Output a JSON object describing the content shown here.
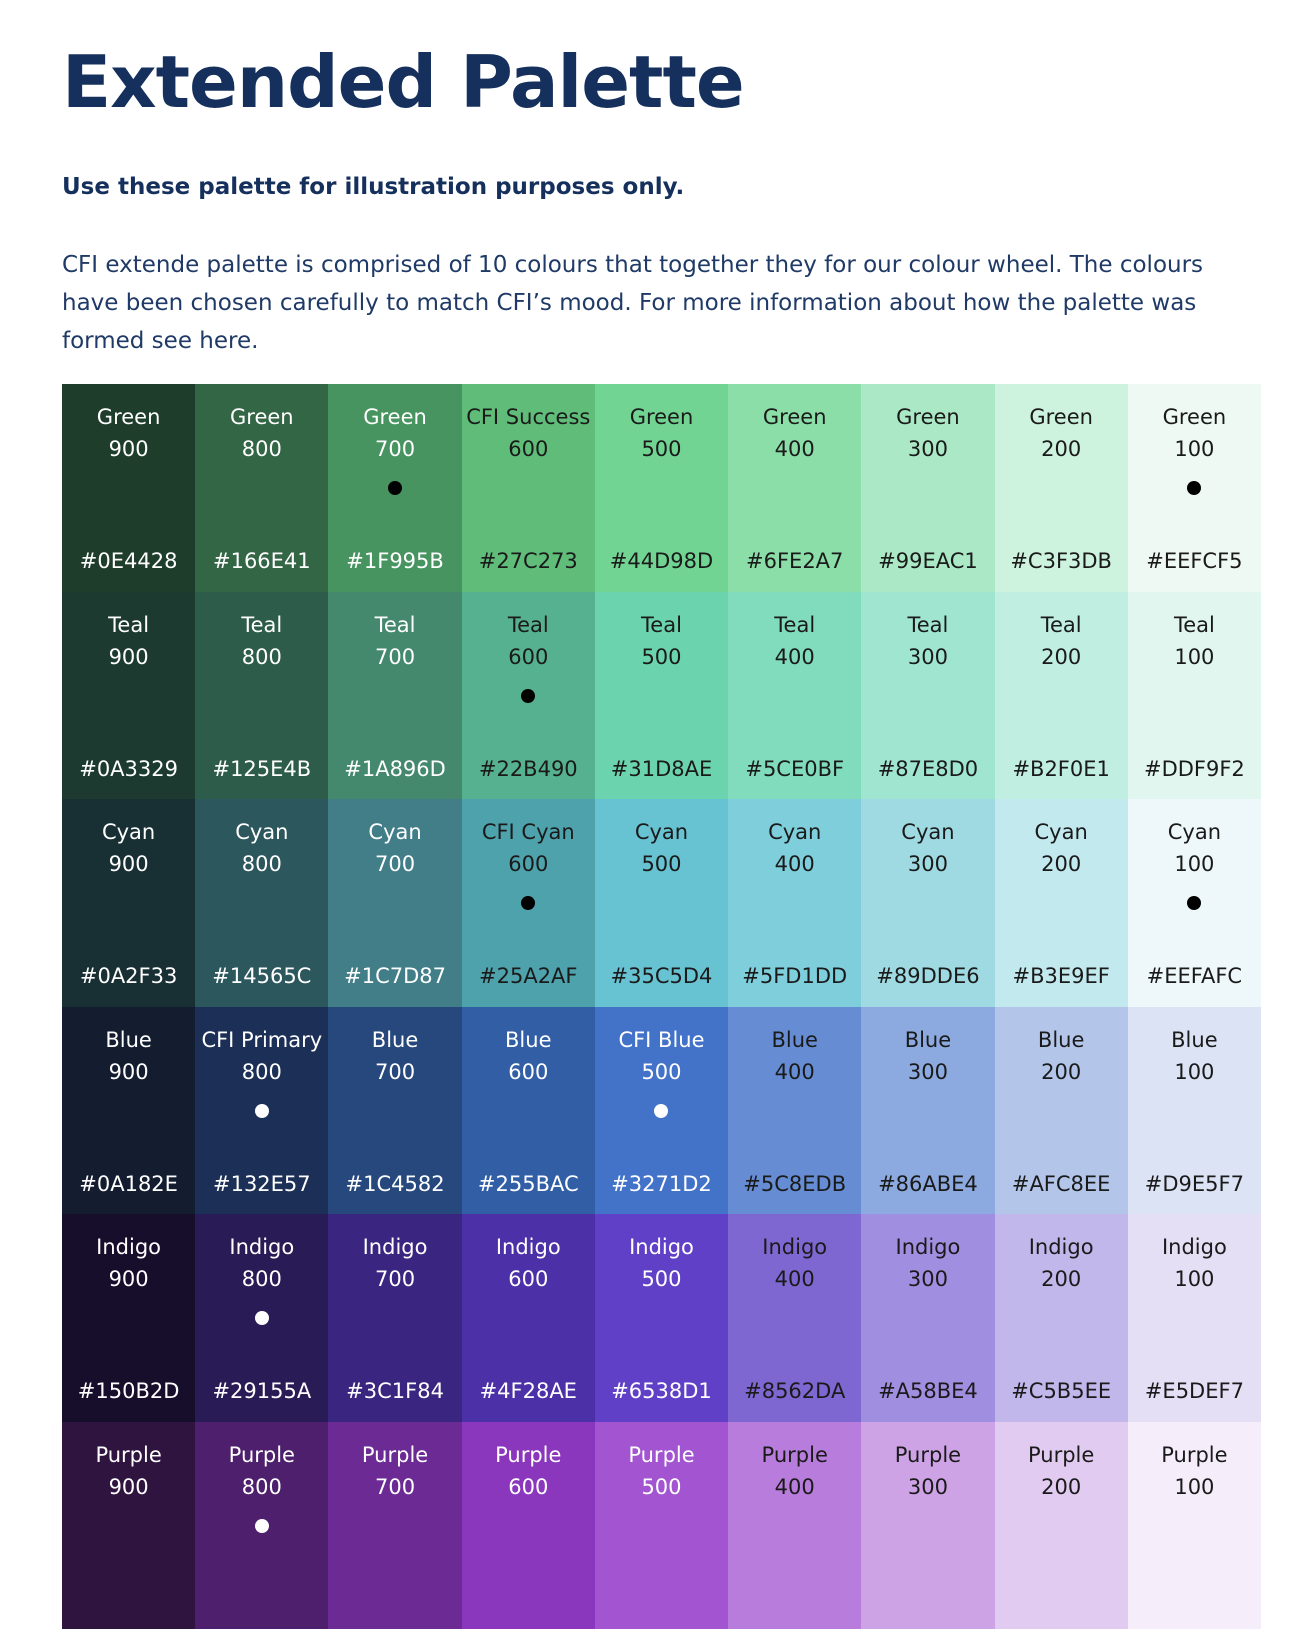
{
  "heading": "Extended Palette",
  "subheading": "Use these palette for illustration purposes only.",
  "intro": "CFI extende palette is comprised of 10 colours that together they for our colour wheel. The colours have been chosen carefully to match CFI’s mood. For more information about how the palette was formed see here.",
  "palette": [
    {
      "row": "green",
      "swatches": [
        {
          "name": "Green",
          "shade": "900",
          "hex": "#0E4428",
          "bg": "#1f3d2b",
          "fg": "#ffffff",
          "dot": false
        },
        {
          "name": "Green",
          "shade": "800",
          "hex": "#166E41",
          "bg": "#336645",
          "fg": "#ffffff",
          "dot": false
        },
        {
          "name": "Green",
          "shade": "700",
          "hex": "#1F995B",
          "bg": "#479460",
          "fg": "#ffffff",
          "dot": true,
          "dot_color": "#000000"
        },
        {
          "name": "CFI Success",
          "shade": "600",
          "hex": "#27C273",
          "bg": "#5fbd79",
          "fg": "#1a1a1a",
          "dot": false
        },
        {
          "name": "Green",
          "shade": "500",
          "hex": "#44D98D",
          "bg": "#72d493",
          "fg": "#1a1a1a",
          "dot": false
        },
        {
          "name": "Green",
          "shade": "400",
          "hex": "#6FE2A7",
          "bg": "#8bdea8",
          "fg": "#1a1a1a",
          "dot": false
        },
        {
          "name": "Green",
          "shade": "300",
          "hex": "#99EAC1",
          "bg": "#abe8c5",
          "fg": "#1a1a1a",
          "dot": false
        },
        {
          "name": "Green",
          "shade": "200",
          "hex": "#C3F3DB",
          "bg": "#cdf2de",
          "fg": "#1a1a1a",
          "dot": false
        },
        {
          "name": "Green",
          "shade": "100",
          "hex": "#EEFCF5",
          "bg": "#edf9f2",
          "fg": "#1a1a1a",
          "dot": true,
          "dot_color": "#000000"
        }
      ]
    },
    {
      "row": "teal",
      "swatches": [
        {
          "name": "Teal",
          "shade": "900",
          "hex": "#0A3329",
          "bg": "#1c3a2f",
          "fg": "#ffffff",
          "dot": false
        },
        {
          "name": "Teal",
          "shade": "800",
          "hex": "#125E4B",
          "bg": "#2d5c4b",
          "fg": "#ffffff",
          "dot": false
        },
        {
          "name": "Teal",
          "shade": "700",
          "hex": "#1A896D",
          "bg": "#44896e",
          "fg": "#ffffff",
          "dot": false
        },
        {
          "name": "Teal",
          "shade": "600",
          "hex": "#22B490",
          "bg": "#56b190",
          "fg": "#1a1a1a",
          "dot": true,
          "dot_color": "#000000"
        },
        {
          "name": "Teal",
          "shade": "500",
          "hex": "#31D8AE",
          "bg": "#6bd4ae",
          "fg": "#1a1a1a",
          "dot": false
        },
        {
          "name": "Teal",
          "shade": "400",
          "hex": "#5CE0BF",
          "bg": "#80dcbd",
          "fg": "#1a1a1a",
          "dot": false
        },
        {
          "name": "Teal",
          "shade": "300",
          "hex": "#87E8D0",
          "bg": "#9fe5d0",
          "fg": "#1a1a1a",
          "dot": false
        },
        {
          "name": "Teal",
          "shade": "200",
          "hex": "#B2F0E1",
          "bg": "#c0eee0",
          "fg": "#1a1a1a",
          "dot": false
        },
        {
          "name": "Teal",
          "shade": "100",
          "hex": "#DDF9F2",
          "bg": "#e1f6ef",
          "fg": "#1a1a1a",
          "dot": false
        }
      ]
    },
    {
      "row": "cyan",
      "swatches": [
        {
          "name": "Cyan",
          "shade": "900",
          "hex": "#0A2F33",
          "bg": "#182f33",
          "fg": "#ffffff",
          "dot": false
        },
        {
          "name": "Cyan",
          "shade": "800",
          "hex": "#14565C",
          "bg": "#2c575d",
          "fg": "#ffffff",
          "dot": false
        },
        {
          "name": "Cyan",
          "shade": "700",
          "hex": "#1C7D87",
          "bg": "#417e88",
          "fg": "#ffffff",
          "dot": false
        },
        {
          "name": "CFI Cyan",
          "shade": "600",
          "hex": "#25A2AF",
          "bg": "#4ea2ac",
          "fg": "#1a1a1a",
          "dot": true,
          "dot_color": "#000000"
        },
        {
          "name": "Cyan",
          "shade": "500",
          "hex": "#35C5D4",
          "bg": "#67c2d1",
          "fg": "#1a1a1a",
          "dot": false
        },
        {
          "name": "Cyan",
          "shade": "400",
          "hex": "#5FD1DD",
          "bg": "#7ecedb",
          "fg": "#1a1a1a",
          "dot": false
        },
        {
          "name": "Cyan",
          "shade": "300",
          "hex": "#89DDE6",
          "bg": "#9fdae3",
          "fg": "#1a1a1a",
          "dot": false
        },
        {
          "name": "Cyan",
          "shade": "200",
          "hex": "#B3E9EF",
          "bg": "#c1e9ee",
          "fg": "#1a1a1a",
          "dot": false
        },
        {
          "name": "Cyan",
          "shade": "100",
          "hex": "#EEFAFC",
          "bg": "#eef8fa",
          "fg": "#1a1a1a",
          "dot": true,
          "dot_color": "#000000"
        }
      ]
    },
    {
      "row": "blue",
      "swatches": [
        {
          "name": "Blue",
          "shade": "900",
          "hex": "#0A182E",
          "bg": "#141c30",
          "fg": "#ffffff",
          "dot": false
        },
        {
          "name": "CFI Primary",
          "shade": "800",
          "hex": "#132E57",
          "bg": "#1c2f56",
          "fg": "#ffffff",
          "dot": true,
          "dot_color": "#ffffff"
        },
        {
          "name": "Blue",
          "shade": "700",
          "hex": "#1C4582",
          "bg": "#27487c",
          "fg": "#ffffff",
          "dot": false
        },
        {
          "name": "Blue",
          "shade": "600",
          "hex": "#255BAC",
          "bg": "#325ea6",
          "fg": "#ffffff",
          "dot": false
        },
        {
          "name": "CFI Blue",
          "shade": "500",
          "hex": "#3271D2",
          "bg": "#4372c9",
          "fg": "#ffffff",
          "dot": true,
          "dot_color": "#ffffff"
        },
        {
          "name": "Blue",
          "shade": "400",
          "hex": "#5C8EDB",
          "bg": "#668dd3",
          "fg": "#1a1a1a",
          "dot": false
        },
        {
          "name": "Blue",
          "shade": "300",
          "hex": "#86ABE4",
          "bg": "#8caadf",
          "fg": "#1a1a1a",
          "dot": false
        },
        {
          "name": "Blue",
          "shade": "200",
          "hex": "#AFC8EE",
          "bg": "#b3c6ea",
          "fg": "#1a1a1a",
          "dot": false
        },
        {
          "name": "Blue",
          "shade": "100",
          "hex": "#D9E5F7",
          "bg": "#dbe3f4",
          "fg": "#1a1a1a",
          "dot": false
        }
      ]
    },
    {
      "row": "indigo",
      "swatches": [
        {
          "name": "Indigo",
          "shade": "900",
          "hex": "#150B2D",
          "bg": "#160e2b",
          "fg": "#ffffff",
          "dot": false
        },
        {
          "name": "Indigo",
          "shade": "800",
          "hex": "#29155A",
          "bg": "#291b55",
          "fg": "#ffffff",
          "dot": true,
          "dot_color": "#ffffff"
        },
        {
          "name": "Indigo",
          "shade": "700",
          "hex": "#3C1F84",
          "bg": "#3a2580",
          "fg": "#ffffff",
          "dot": false
        },
        {
          "name": "Indigo",
          "shade": "600",
          "hex": "#4F28AE",
          "bg": "#4c30a8",
          "fg": "#ffffff",
          "dot": false
        },
        {
          "name": "Indigo",
          "shade": "500",
          "hex": "#6538D1",
          "bg": "#6140c8",
          "fg": "#ffffff",
          "dot": false
        },
        {
          "name": "Indigo",
          "shade": "400",
          "hex": "#8562DA",
          "bg": "#7e67d1",
          "fg": "#1a1a1a",
          "dot": false
        },
        {
          "name": "Indigo",
          "shade": "300",
          "hex": "#A58BE4",
          "bg": "#a08fe0",
          "fg": "#1a1a1a",
          "dot": false
        },
        {
          "name": "Indigo",
          "shade": "200",
          "hex": "#C5B5EE",
          "bg": "#c1b7eb",
          "fg": "#1a1a1a",
          "dot": false
        },
        {
          "name": "Indigo",
          "shade": "100",
          "hex": "#E5DEF7",
          "bg": "#e4dff4",
          "fg": "#1a1a1a",
          "dot": false
        }
      ]
    },
    {
      "row": "purple",
      "swatches": [
        {
          "name": "Purple",
          "shade": "900",
          "hex": "",
          "bg": "#2f143f",
          "fg": "#ffffff",
          "dot": false
        },
        {
          "name": "Purple",
          "shade": "800",
          "hex": "",
          "bg": "#4d1f6c",
          "fg": "#ffffff",
          "dot": true,
          "dot_color": "#ffffff"
        },
        {
          "name": "Purple",
          "shade": "700",
          "hex": "",
          "bg": "#6c2b94",
          "fg": "#ffffff",
          "dot": false
        },
        {
          "name": "Purple",
          "shade": "600",
          "hex": "",
          "bg": "#8b37bd",
          "fg": "#ffffff",
          "dot": false
        },
        {
          "name": "Purple",
          "shade": "500",
          "hex": "",
          "bg": "#a354d0",
          "fg": "#ffffff",
          "dot": false
        },
        {
          "name": "Purple",
          "shade": "400",
          "hex": "",
          "bg": "#b87cdc",
          "fg": "#1a1a1a",
          "dot": false
        },
        {
          "name": "Purple",
          "shade": "300",
          "hex": "",
          "bg": "#cda3e6",
          "fg": "#1a1a1a",
          "dot": false
        },
        {
          "name": "Purple",
          "shade": "200",
          "hex": "",
          "bg": "#e1cbf0",
          "fg": "#1a1a1a",
          "dot": false
        },
        {
          "name": "Purple",
          "shade": "100",
          "hex": "",
          "bg": "#f5eefa",
          "fg": "#1a1a1a",
          "dot": false
        }
      ]
    }
  ]
}
